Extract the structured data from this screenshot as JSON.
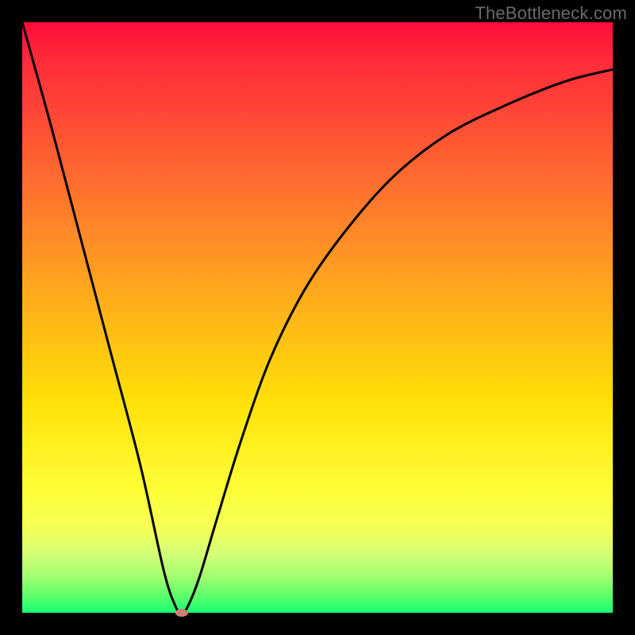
{
  "watermark": "TheBottleneck.com",
  "chart_data": {
    "type": "line",
    "title": "",
    "xlabel": "",
    "ylabel": "",
    "xlim": [
      0,
      100
    ],
    "ylim": [
      0,
      100
    ],
    "grid": false,
    "background": "rainbow-vertical-gradient",
    "series": [
      {
        "name": "bottleneck-curve",
        "x": [
          0,
          5,
          10,
          15,
          20,
          24,
          26,
          27,
          28,
          30,
          33,
          37,
          42,
          48,
          55,
          63,
          72,
          82,
          92,
          100
        ],
        "y": [
          100,
          82,
          63,
          44,
          25,
          7,
          1,
          0,
          1,
          6,
          16,
          29,
          43,
          55,
          65,
          74,
          81,
          86,
          90,
          92
        ]
      }
    ],
    "marker": {
      "x": 27,
      "y": 0,
      "shape": "ellipse",
      "color": "#d08070"
    }
  }
}
